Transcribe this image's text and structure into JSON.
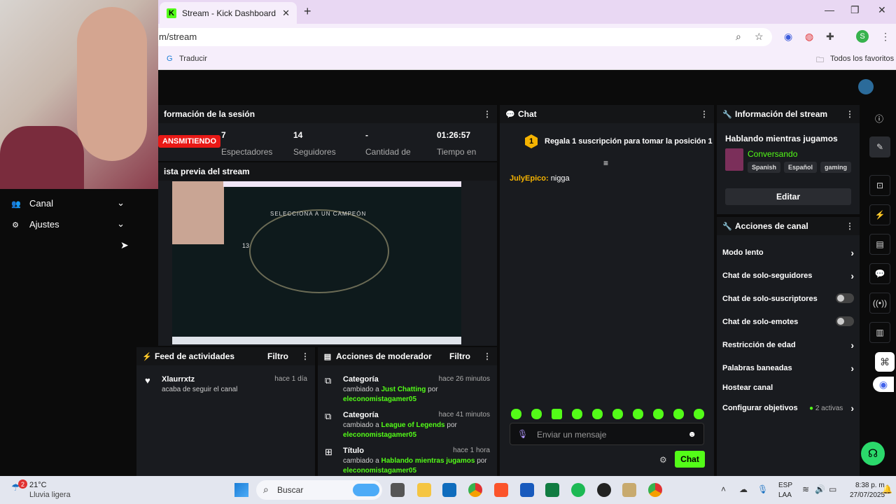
{
  "browser": {
    "tab_title": "Stream - Kick Dashboard",
    "tab_fav": "K",
    "new_tab": "+",
    "url": "m/stream",
    "bookmark_traducir": "Traducir",
    "bookmark_all": "Todos los favoritos",
    "profile_initial": "S"
  },
  "sidebar": {
    "items": [
      {
        "label": "Canal",
        "icon": "users-icon"
      },
      {
        "label": "Ajustes",
        "icon": "gear-icon"
      }
    ]
  },
  "session": {
    "title": "formación de la sesión",
    "live_label": "ANSMITIENDO",
    "stats": [
      {
        "value": "7",
        "label": "Espectadores"
      },
      {
        "value": "14",
        "label": "Seguidores"
      },
      {
        "value": "-",
        "label": "Cantidad de"
      },
      {
        "value": "01:26:57",
        "label": "Tiempo en"
      }
    ]
  },
  "preview": {
    "title": "ista previa del stream",
    "game_text": "SELECCIONA A UN CAMPEÓN",
    "timer": "13"
  },
  "feed": {
    "title": "Feed de actividades",
    "filter": "Filtro",
    "items": [
      {
        "user": "Xlaurrxtz",
        "text": "acaba de seguir el canal",
        "time": "hace 1 día"
      }
    ]
  },
  "mod": {
    "title": "Acciones de moderador",
    "filter": "Filtro",
    "items": [
      {
        "title": "Categoría",
        "prefix": "cambiado a",
        "value": "Just Chatting",
        "por": "por",
        "user": "eleconomistagamer05",
        "time": "hace 26 minutos"
      },
      {
        "title": "Categoría",
        "prefix": "cambiado a",
        "value": "League of Legends",
        "por": "por",
        "user": "eleconomistagamer05",
        "time": "hace 41 minutos"
      },
      {
        "title": "Título",
        "prefix": "cambiado a",
        "value": "Hablando mientras jugamos",
        "por": "por",
        "user": "eleconomistagamer05",
        "time": "hace 1 hora"
      }
    ]
  },
  "chat": {
    "title": "Chat",
    "gift_rank": "1",
    "gift_text": "Regala 1 suscripción para tomar la posición 1",
    "messages": [
      {
        "user": "JulyEpico:",
        "text": "nigga"
      }
    ],
    "input_placeholder": "Enviar un mensaje",
    "send_label": "Chat"
  },
  "stream_info": {
    "title": "Información del stream",
    "stream_title": "Hablando mientras jugamos",
    "category": "Conversando",
    "tags": [
      "Spanish",
      "Español",
      "gaming"
    ],
    "edit_label": "Editar"
  },
  "channel_actions": {
    "title": "Acciones de canal",
    "items": [
      {
        "label": "Modo lento",
        "kind": "chevron"
      },
      {
        "label": "Chat de solo-seguidores",
        "kind": "chevron"
      },
      {
        "label": "Chat de solo-suscriptores",
        "kind": "toggle"
      },
      {
        "label": "Chat de solo-emotes",
        "kind": "toggle"
      },
      {
        "label": "Restricción de edad",
        "kind": "chevron"
      },
      {
        "label": "Palabras baneadas",
        "kind": "chevron"
      },
      {
        "label": "Hostear canal",
        "kind": "none"
      },
      {
        "label": "Configurar objetivos",
        "kind": "chevron"
      }
    ],
    "goals_active": "2 activas"
  },
  "taskbar": {
    "weather_temp": "21°C",
    "weather_desc": "Lluvia ligera",
    "weather_badge": "2",
    "search": "Buscar",
    "lang1": "ESP",
    "lang2": "LAA",
    "time": "8:38 p. m.",
    "date": "27/07/2025"
  },
  "colors": {
    "accent": "#53fc18",
    "live": "#e91916",
    "panel": "#191b1f"
  }
}
